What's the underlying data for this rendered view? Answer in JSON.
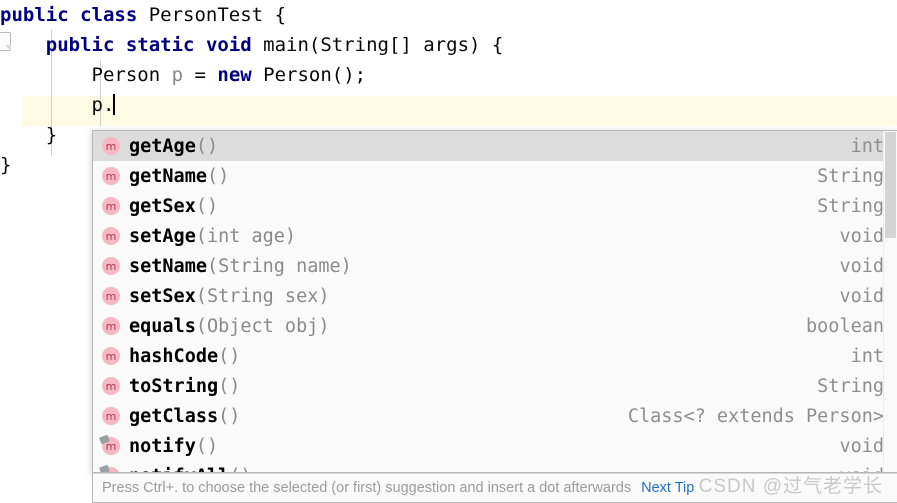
{
  "editor": {
    "lines": [
      {
        "indent": "",
        "tokens": [
          {
            "t": "kw",
            "s": "public"
          },
          {
            "t": "plain",
            "s": " "
          },
          {
            "t": "kw",
            "s": "class"
          },
          {
            "t": "plain",
            "s": " PersonTest {"
          }
        ]
      },
      {
        "indent": "    ",
        "tokens": [
          {
            "t": "kw",
            "s": "public"
          },
          {
            "t": "plain",
            "s": " "
          },
          {
            "t": "kw",
            "s": "static"
          },
          {
            "t": "plain",
            "s": " "
          },
          {
            "t": "kw",
            "s": "void"
          },
          {
            "t": "plain",
            "s": " main(String[] args) {"
          }
        ]
      },
      {
        "indent": "        ",
        "tokens": [
          {
            "t": "plain",
            "s": "Person "
          },
          {
            "t": "localvar",
            "s": "p"
          },
          {
            "t": "plain",
            "s": " = "
          },
          {
            "t": "kw",
            "s": "new"
          },
          {
            "t": "plain",
            "s": " Person();"
          }
        ]
      },
      {
        "indent": "        ",
        "tokens": [
          {
            "t": "plain",
            "s": "p."
          }
        ],
        "caret": true
      },
      {
        "indent": "    ",
        "tokens": [
          {
            "t": "plain",
            "s": "}"
          }
        ]
      },
      {
        "indent": "",
        "tokens": [
          {
            "t": "plain",
            "s": "}"
          }
        ]
      }
    ],
    "gutter_icon": "run-gutter-icon"
  },
  "completion": {
    "selected_index": 0,
    "icon_label": "m",
    "items": [
      {
        "name": "getAge",
        "params": "()",
        "type": "int",
        "final": false
      },
      {
        "name": "getName",
        "params": "()",
        "type": "String",
        "final": false
      },
      {
        "name": "getSex",
        "params": "()",
        "type": "String",
        "final": false
      },
      {
        "name": "setAge",
        "params": "(int age)",
        "type": "void",
        "final": false
      },
      {
        "name": "setName",
        "params": "(String name)",
        "type": "void",
        "final": false
      },
      {
        "name": "setSex",
        "params": "(String sex)",
        "type": "void",
        "final": false
      },
      {
        "name": "equals",
        "params": "(Object obj)",
        "type": "boolean",
        "final": false
      },
      {
        "name": "hashCode",
        "params": "()",
        "type": "int",
        "final": false
      },
      {
        "name": "toString",
        "params": "()",
        "type": "String",
        "final": false
      },
      {
        "name": "getClass",
        "params": "()",
        "type": "Class<? extends Person>",
        "final": false
      },
      {
        "name": "notify",
        "params": "()",
        "type": "void",
        "final": true
      },
      {
        "name": "notifyAll",
        "params": "()",
        "type": "void",
        "final": true
      }
    ]
  },
  "tipbar": {
    "text": "Press Ctrl+. to choose the selected (or first) suggestion and insert a dot afterwards",
    "link": "Next Tip"
  },
  "watermark": {
    "text": "CSDN @过气老学长"
  },
  "colors": {
    "keyword": "#000080",
    "selection": "#dcdcdc",
    "current_line": "#fffae3",
    "method_icon": "#f6b8c2",
    "type_text": "#8e8e8e",
    "link": "#2470c0"
  }
}
